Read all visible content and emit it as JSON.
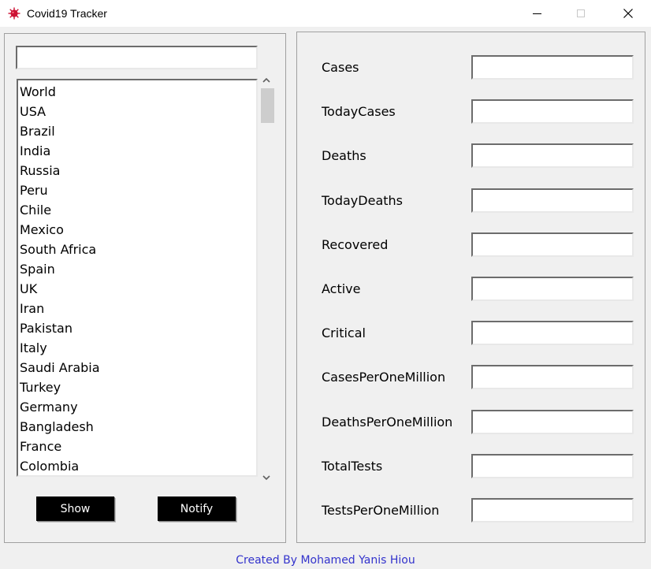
{
  "window": {
    "title": "Covid19 Tracker",
    "app_icon": "virus-icon",
    "controls": [
      "minimize-icon",
      "maximize-icon",
      "close-icon"
    ]
  },
  "search": {
    "value": "",
    "placeholder": ""
  },
  "countries": [
    "World",
    "USA",
    "Brazil",
    "India",
    "Russia",
    "Peru",
    "Chile",
    "Mexico",
    "South Africa",
    "Spain",
    "UK",
    "Iran",
    "Pakistan",
    "Italy",
    "Saudi Arabia",
    "Turkey",
    "Germany",
    "Bangladesh",
    "France",
    "Colombia"
  ],
  "buttons": {
    "show": "Show",
    "notify": "Notify"
  },
  "fields": [
    {
      "label": "Cases",
      "value": ""
    },
    {
      "label": "TodayCases",
      "value": ""
    },
    {
      "label": "Deaths",
      "value": ""
    },
    {
      "label": "TodayDeaths",
      "value": ""
    },
    {
      "label": "Recovered",
      "value": ""
    },
    {
      "label": "Active",
      "value": ""
    },
    {
      "label": "Critical",
      "value": ""
    },
    {
      "label": "CasesPerOneMillion",
      "value": ""
    },
    {
      "label": "DeathsPerOneMillion",
      "value": ""
    },
    {
      "label": "TotalTests",
      "value": ""
    },
    {
      "label": "TestsPerOneMillion",
      "value": ""
    }
  ],
  "footer": "Created By Mohamed Yanis Hiou",
  "colors": {
    "footer_text": "#3333cc",
    "button_bg": "#000000",
    "button_text": "#ffffff",
    "app_icon": "#cc1133"
  }
}
